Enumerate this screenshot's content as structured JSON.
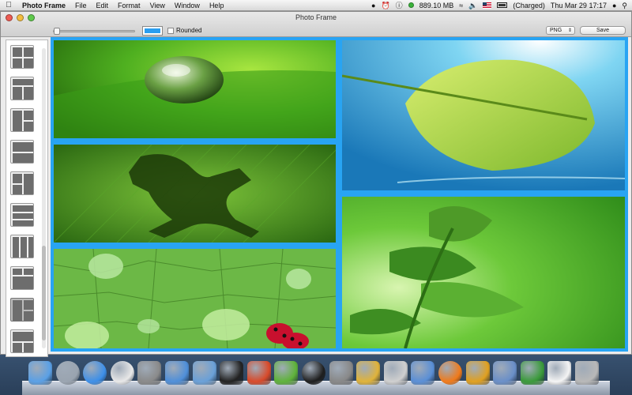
{
  "menubar": {
    "apple_icon": "apple-icon",
    "app_name": "Photo Frame",
    "menus": [
      "File",
      "Edit",
      "Format",
      "View",
      "Window",
      "Help"
    ],
    "status": {
      "memory": "889.10 MB",
      "battery": "(Charged)",
      "datetime": "Thu Mar 29  17:17"
    }
  },
  "window": {
    "title": "Photo Frame",
    "toolbar": {
      "rounded_label": "Rounded",
      "rounded_checked": false,
      "frame_color": "#2a9ef0",
      "format_value": "PNG",
      "save_label": "Save"
    },
    "layouts_count": 10,
    "selected_layout_index": 8
  },
  "canvas": {
    "border_color": "#28a4f3",
    "photos": [
      {
        "name": "waterdrop-leaf-photo",
        "dominant": "#5ec22c"
      },
      {
        "name": "frog-silhouette-photo",
        "dominant": "#3c8a14"
      },
      {
        "name": "wet-leaf-ladybugs-photo",
        "dominant": "#6cb846"
      },
      {
        "name": "floating-leaf-water-photo",
        "dominant": "#4fb8d8"
      },
      {
        "name": "green-plant-photo",
        "dominant": "#52b83a"
      }
    ]
  },
  "dock": {
    "apps": [
      "finder-icon",
      "launchpad-icon",
      "app-store-icon",
      "chrome-icon",
      "system-preferences-icon",
      "xcode-icon",
      "xcode-instruments-icon",
      "terminal-icon",
      "flash-icon",
      "evernote-icon",
      "sound-studio-icon",
      "stocks-icon",
      "wunderlist-icon",
      "calculator-icon",
      "preview-icon",
      "firefox-icon",
      "mosaic-icon",
      "photo-gallery-icon",
      "wrench-icon",
      "documents-icon",
      "trash-icon"
    ]
  }
}
